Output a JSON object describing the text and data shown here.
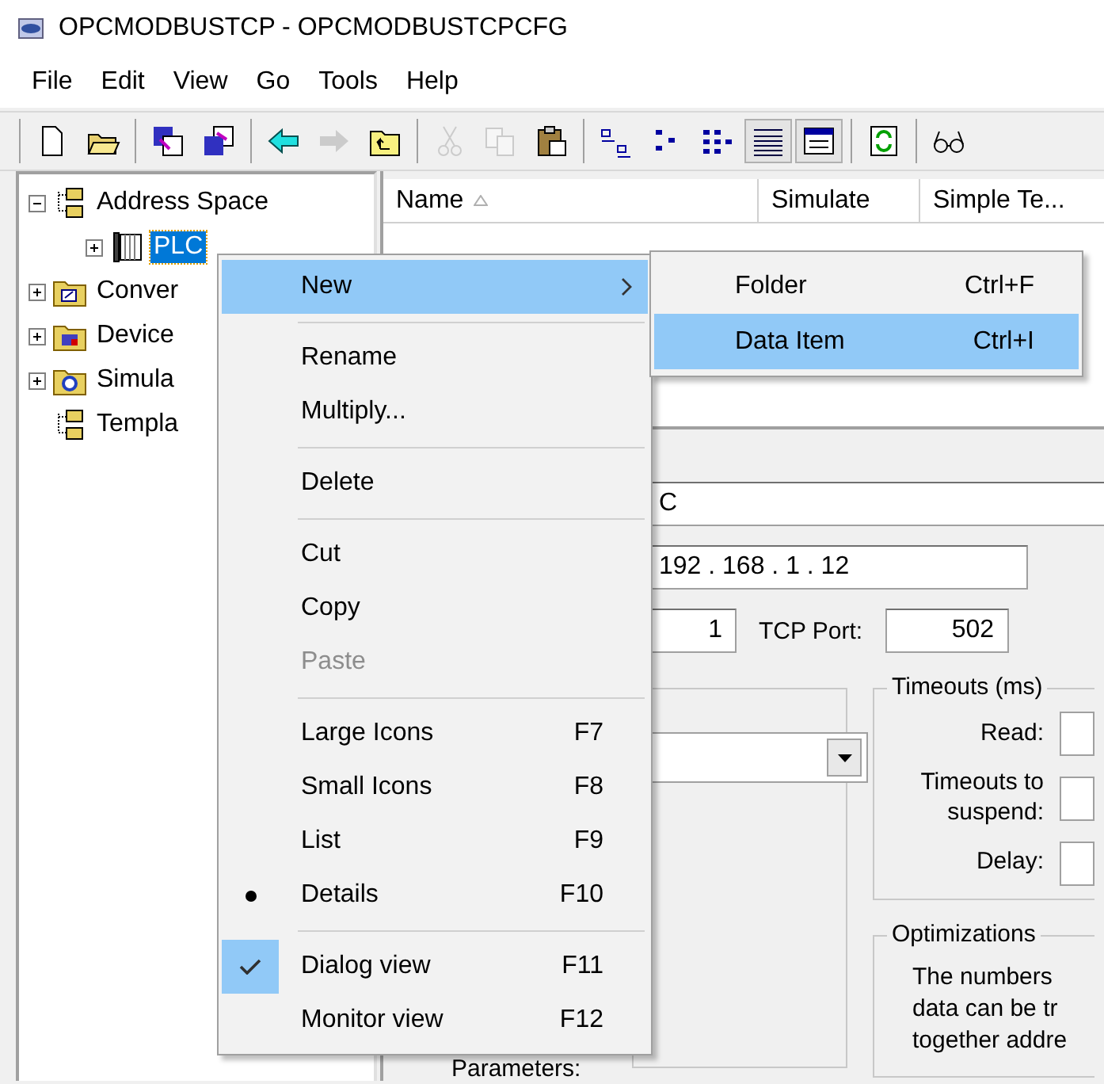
{
  "window": {
    "title": "OPCMODBUSTCP - OPCMODBUSTCPCFG"
  },
  "menu_bar": [
    "File",
    "Edit",
    "View",
    "Go",
    "Tools",
    "Help"
  ],
  "toolbar": [
    [
      {
        "disabled": false,
        "pressed": false
      },
      {
        "disabled": false,
        "pressed": false
      }
    ],
    [
      {
        "disabled": false,
        "pressed": false
      },
      {
        "disabled": false,
        "pressed": false
      }
    ],
    [
      {
        "disabled": false,
        "pressed": false
      },
      {
        "disabled": true,
        "pressed": false
      },
      {
        "disabled": false,
        "pressed": false
      }
    ],
    [
      {
        "disabled": true,
        "pressed": false
      },
      {
        "disabled": true,
        "pressed": false
      },
      {
        "disabled": false,
        "pressed": false
      }
    ],
    [
      {
        "disabled": false,
        "pressed": false
      },
      {
        "disabled": false,
        "pressed": false
      },
      {
        "disabled": false,
        "pressed": false
      },
      {
        "disabled": false,
        "pressed": true
      },
      {
        "disabled": false,
        "pressed": true
      }
    ],
    [
      {
        "disabled": false,
        "pressed": false
      }
    ],
    [
      {
        "disabled": false,
        "pressed": false
      }
    ]
  ],
  "tree": [
    {
      "label": "Address Space",
      "kind": "space",
      "expanded": true,
      "selected": false,
      "children": [
        {
          "label": "PLC",
          "kind": "device",
          "expanded": false,
          "selected": true
        }
      ]
    },
    {
      "label": "Conver",
      "kind": "conversion",
      "expanded": false,
      "selected": false
    },
    {
      "label": "Device",
      "kind": "device-folder",
      "expanded": false,
      "selected": false
    },
    {
      "label": "Simula",
      "kind": "simulation",
      "expanded": false,
      "selected": false
    },
    {
      "label": "Templa",
      "kind": "space",
      "selected": false
    }
  ],
  "list": {
    "columns": [
      {
        "label": "Name",
        "sorted": true
      },
      {
        "label": "Simulate",
        "sorted": false
      },
      {
        "label": "Simple Te...",
        "sorted": false
      }
    ]
  },
  "form": {
    "name_value": "C",
    "ip_value": "192 . 168 . 1 . 12",
    "id_value": "1",
    "port_label": "TCP Port:",
    "port_value": "502",
    "parameters_label": "Parameters:",
    "timeouts": {
      "title": "Timeouts (ms)",
      "labels": [
        "Read:",
        "Timeouts to suspend:",
        "Delay:"
      ]
    },
    "optimizations": {
      "title": "Optimizations",
      "lines": [
        "The numbers",
        "data can be tr",
        "together addre"
      ]
    }
  },
  "context_menu": [
    {
      "kind": "item",
      "label": "New",
      "highlighted": true,
      "disabled": false,
      "submenu": true
    },
    {
      "kind": "separator"
    },
    {
      "kind": "item",
      "label": "Rename",
      "highlighted": false,
      "disabled": false,
      "submenu": false
    },
    {
      "kind": "item",
      "label": "Multiply...",
      "highlighted": false,
      "disabled": false,
      "submenu": false
    },
    {
      "kind": "separator"
    },
    {
      "kind": "item",
      "label": "Delete",
      "highlighted": false,
      "disabled": false,
      "submenu": false
    },
    {
      "kind": "separator"
    },
    {
      "kind": "item",
      "label": "Cut",
      "highlighted": false,
      "disabled": false,
      "submenu": false
    },
    {
      "kind": "item",
      "label": "Copy",
      "highlighted": false,
      "disabled": false,
      "submenu": false
    },
    {
      "kind": "item",
      "label": "Paste",
      "highlighted": false,
      "disabled": true,
      "submenu": false
    },
    {
      "kind": "separator"
    },
    {
      "kind": "item",
      "label": "Large Icons",
      "shortcut": "F7",
      "highlighted": false,
      "disabled": false,
      "submenu": false
    },
    {
      "kind": "item",
      "label": "Small Icons",
      "shortcut": "F8",
      "highlighted": false,
      "disabled": false,
      "submenu": false
    },
    {
      "kind": "item",
      "label": "List",
      "shortcut": "F9",
      "highlighted": false,
      "disabled": false,
      "submenu": false
    },
    {
      "kind": "radio",
      "label": "Details",
      "shortcut": "F10",
      "highlighted": false,
      "disabled": false,
      "submenu": false,
      "checked": true
    },
    {
      "kind": "separator"
    },
    {
      "kind": "check",
      "label": "Dialog view",
      "shortcut": "F11",
      "highlighted": false,
      "disabled": false,
      "submenu": false,
      "checked": true
    },
    {
      "kind": "item",
      "label": "Monitor view",
      "shortcut": "F12",
      "highlighted": false,
      "disabled": false,
      "submenu": false
    }
  ],
  "submenu": [
    {
      "label": "Folder",
      "shortcut": "Ctrl+F",
      "highlighted": false
    },
    {
      "label": "Data Item",
      "shortcut": "Ctrl+I",
      "highlighted": true
    }
  ]
}
